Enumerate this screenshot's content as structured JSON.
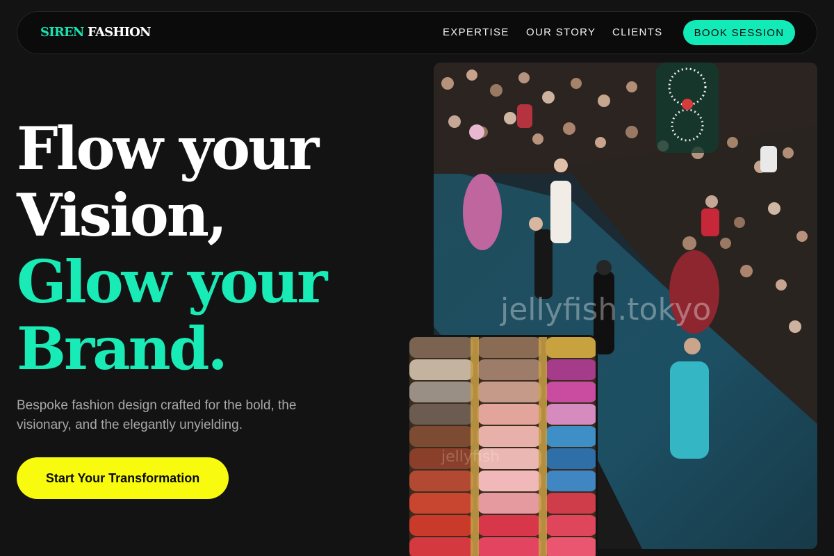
{
  "brand": {
    "accent": "SIREN",
    "name": "FASHION"
  },
  "nav": {
    "links": [
      "EXPERTISE",
      "OUR STORY",
      "CLIENTS"
    ],
    "cta": "BOOK SESSION"
  },
  "hero": {
    "line1": "Flow your",
    "line2": "Vision,",
    "line3": "Glow your",
    "line4": "Brand.",
    "subtitle": "Bespoke fashion design crafted for the bold, the visionary, and the elegantly unyielding.",
    "cta": "Start Your Transformation"
  },
  "images": {
    "runway_watermark": "jellyfish.tokyo",
    "threads_watermark": "jellyfish"
  },
  "colors": {
    "background": "#131313",
    "accent": "#18ebb5",
    "cta": "#f8fb0e"
  }
}
